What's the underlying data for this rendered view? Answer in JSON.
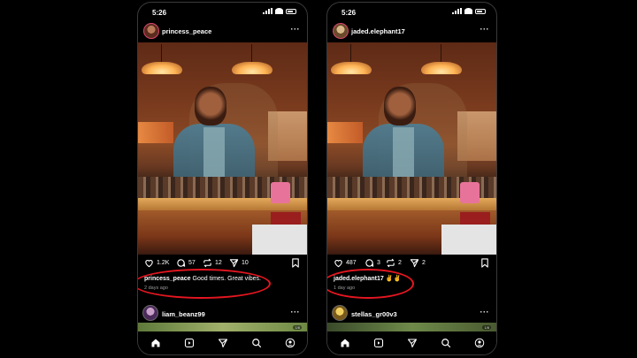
{
  "phones": [
    {
      "status_time": "5:26",
      "username": "princess_peace",
      "more": "···",
      "likes": "1.2K",
      "comments": "57",
      "reposts": "12",
      "shares": "10",
      "caption_user": "princess_peace",
      "caption_text": "Good times. Great vibes.",
      "time_ago": "2 days ago",
      "next_username": "liam_beanz99",
      "next_page": "1/8"
    },
    {
      "status_time": "5:26",
      "username": "jaded.elephant17",
      "more": "···",
      "likes": "487",
      "comments": "3",
      "reposts": "2",
      "shares": "2",
      "caption_user": "jaded.elephant17",
      "caption_text": "✌️✌️",
      "time_ago": "1 day ago",
      "next_username": "stellas_gr00v3",
      "next_page": "1/8"
    }
  ],
  "icons": {
    "like": "heart-icon",
    "comment": "comment-icon",
    "repost": "repost-icon",
    "share": "send-icon",
    "save": "bookmark-icon",
    "tabs": [
      "home-icon",
      "reels-icon",
      "send-icon",
      "search-icon",
      "profile-icon"
    ]
  },
  "colors": {
    "highlight": "#e51620",
    "background": "#000000",
    "story_ring": "#d9456c"
  }
}
